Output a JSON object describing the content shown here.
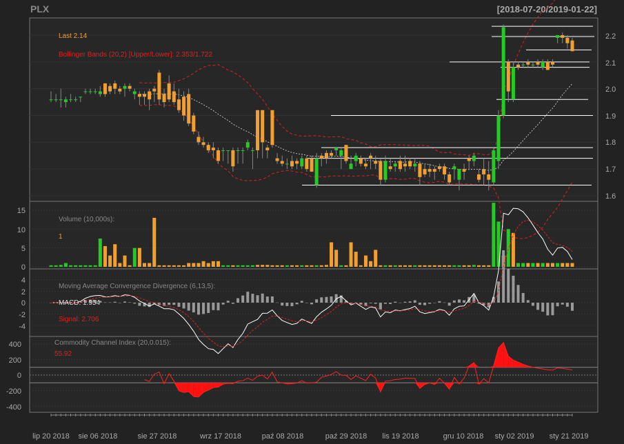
{
  "header": {
    "symbol": "PLX",
    "range": "[2018-07-20/2019-01-22]"
  },
  "colors": {
    "bg": "#222222",
    "panel": "#2b2b2b",
    "grid": "#3a3a3a",
    "frame": "#888888",
    "up": "#22cc22",
    "down": "#f0a030",
    "bb": "#dd2222",
    "text": "#aaaaaa",
    "last": "#f0a030",
    "label_red": "#dd2222",
    "white": "#ffffff",
    "title": "#999999"
  },
  "price_panel": {
    "last_label": "Last 2.14",
    "bb_label": "Bollinger Bands (20,2) [Upper/Lower]: 2.353/1.722",
    "yticks": [
      "2.2",
      "2.1",
      "2.0",
      "1.9",
      "1.8",
      "1.7",
      "1.6"
    ]
  },
  "volume_panel": {
    "title": "Volume (10,000s):",
    "value": "1",
    "yticks": [
      "15",
      "10",
      "5",
      "0"
    ]
  },
  "macd_panel": {
    "title": "Moving Average Convergence Divergence (6,13,5):",
    "macd_label": "MACD: 1.954",
    "signal_label": "Signal: 2.706",
    "yticks": [
      "4",
      "2",
      "0",
      "-2",
      "-4"
    ]
  },
  "cci_panel": {
    "title": "Commodity Channel Index (20,0.015):",
    "value": "55.92",
    "yticks": [
      "400",
      "200",
      "0",
      "-200",
      "-400"
    ]
  },
  "x_axis": {
    "labels": [
      "lip 20 2018",
      "sie 06 2018",
      "sie 27 2018",
      "wrz 17 2018",
      "paź 08 2018",
      "paź 29 2018",
      "lis 19 2018",
      "gru 10 2018",
      "sty 02 2019",
      "sty 21 2019"
    ]
  },
  "chart_data": {
    "type": "candlestick",
    "title": "PLX",
    "date_range": "[2018-07-20/2019-01-22]",
    "ylim_price": [
      1.57,
      2.27
    ],
    "ylim_volume": [
      0,
      18
    ],
    "ylim_macd": [
      -6,
      6
    ],
    "ylim_cci": [
      -500,
      500
    ],
    "candles": [
      {
        "o": 1.96,
        "h": 1.99,
        "l": 1.95,
        "c": 1.96,
        "v": 0.1
      },
      {
        "o": 1.96,
        "h": 1.98,
        "l": 1.95,
        "c": 1.96,
        "v": 0.1
      },
      {
        "o": 1.96,
        "h": 2.0,
        "l": 1.93,
        "c": 1.96,
        "v": 0.5
      },
      {
        "o": 1.95,
        "h": 1.97,
        "l": 1.93,
        "c": 1.96,
        "v": 1.0
      },
      {
        "o": 1.96,
        "h": 1.98,
        "l": 1.95,
        "c": 1.96,
        "v": 0.1
      },
      {
        "o": 1.96,
        "h": 1.97,
        "l": 1.95,
        "c": 1.96,
        "v": 0.1
      },
      {
        "o": 1.97,
        "h": 1.97,
        "l": 1.95,
        "c": 1.97,
        "v": 0.1
      },
      {
        "o": 1.99,
        "h": 2.0,
        "l": 1.98,
        "c": 1.99,
        "v": 0.1
      },
      {
        "o": 1.99,
        "h": 2.0,
        "l": 1.98,
        "c": 1.99,
        "v": 0.1
      },
      {
        "o": 1.99,
        "h": 2.0,
        "l": 1.98,
        "c": 1.99,
        "v": 0.1
      },
      {
        "o": 1.98,
        "h": 2.01,
        "l": 1.97,
        "c": 1.99,
        "v": 7.5
      },
      {
        "o": 2.02,
        "h": 2.02,
        "l": 1.97,
        "c": 1.98,
        "v": 5.5
      },
      {
        "o": 2.01,
        "h": 2.02,
        "l": 1.98,
        "c": 1.99,
        "v": 3.0
      },
      {
        "o": 2.02,
        "h": 2.03,
        "l": 1.98,
        "c": 2.0,
        "v": 6.0
      },
      {
        "o": 2.0,
        "h": 2.01,
        "l": 1.98,
        "c": 1.99,
        "v": 1.0
      },
      {
        "o": 2.0,
        "h": 2.02,
        "l": 1.97,
        "c": 2.01,
        "v": 0.1
      },
      {
        "o": 2.01,
        "h": 2.02,
        "l": 1.99,
        "c": 2.0,
        "v": 0.1
      },
      {
        "o": 1.98,
        "h": 2.0,
        "l": 1.96,
        "c": 1.99,
        "v": 1.5
      },
      {
        "o": 1.98,
        "h": 1.99,
        "l": 1.94,
        "c": 1.97,
        "v": 5.0
      },
      {
        "o": 1.98,
        "h": 1.99,
        "l": 1.94,
        "c": 1.97,
        "v": 1.0
      },
      {
        "o": 1.99,
        "h": 2.0,
        "l": 1.92,
        "c": 1.96,
        "v": 1.0
      },
      {
        "o": 2.0,
        "h": 2.01,
        "l": 1.95,
        "c": 1.99,
        "v": 13.0
      },
      {
        "o": 2.06,
        "h": 2.07,
        "l": 1.94,
        "c": 1.96,
        "v": 0.1
      },
      {
        "o": 1.98,
        "h": 2.0,
        "l": 1.93,
        "c": 1.95,
        "v": 0.1
      },
      {
        "o": 2.02,
        "h": 2.05,
        "l": 1.95,
        "c": 1.96,
        "v": 0.1
      },
      {
        "o": 1.99,
        "h": 2.02,
        "l": 1.94,
        "c": 1.95,
        "v": 0.1
      },
      {
        "o": 1.96,
        "h": 2.0,
        "l": 1.91,
        "c": 1.92,
        "v": 0.1
      },
      {
        "o": 1.97,
        "h": 1.99,
        "l": 1.88,
        "c": 1.9,
        "v": 0.1
      },
      {
        "o": 1.98,
        "h": 2.0,
        "l": 1.86,
        "c": 1.87,
        "v": 1.0
      },
      {
        "o": 1.9,
        "h": 1.91,
        "l": 1.83,
        "c": 1.84,
        "v": 1.0
      },
      {
        "o": 1.82,
        "h": 1.84,
        "l": 1.79,
        "c": 1.8,
        "v": 1.0
      },
      {
        "o": 1.8,
        "h": 1.82,
        "l": 1.78,
        "c": 1.79,
        "v": 1.5
      },
      {
        "o": 1.79,
        "h": 1.8,
        "l": 1.76,
        "c": 1.77,
        "v": 1.0
      },
      {
        "o": 1.78,
        "h": 1.8,
        "l": 1.74,
        "c": 1.77,
        "v": 1.5
      },
      {
        "o": 1.77,
        "h": 1.78,
        "l": 1.72,
        "c": 1.73,
        "v": 1.5
      },
      {
        "o": 1.77,
        "h": 1.78,
        "l": 1.73,
        "c": 1.77,
        "v": 0.1
      },
      {
        "o": 1.77,
        "h": 1.77,
        "l": 1.72,
        "c": 1.77,
        "v": 0.1
      },
      {
        "o": 1.77,
        "h": 1.78,
        "l": 1.69,
        "c": 1.71,
        "v": 0.1
      },
      {
        "o": 1.77,
        "h": 1.78,
        "l": 1.72,
        "c": 1.77,
        "v": 0.1
      },
      {
        "o": 1.77,
        "h": 1.78,
        "l": 1.72,
        "c": 1.77,
        "v": 0.1
      },
      {
        "o": 1.78,
        "h": 1.81,
        "l": 1.77,
        "c": 1.8,
        "v": 0.1
      },
      {
        "o": 1.77,
        "h": 1.78,
        "l": 1.7,
        "c": 1.77,
        "v": 0.1
      },
      {
        "o": 1.92,
        "h": 1.92,
        "l": 1.74,
        "c": 1.77,
        "v": 0.5
      },
      {
        "o": 1.92,
        "h": 1.92,
        "l": 1.74,
        "c": 1.8,
        "v": 0.5
      },
      {
        "o": 1.78,
        "h": 1.79,
        "l": 1.74,
        "c": 1.77,
        "v": 0.5
      },
      {
        "o": 1.92,
        "h": 1.92,
        "l": 1.78,
        "c": 1.79,
        "v": 0.1
      },
      {
        "o": 1.74,
        "h": 1.76,
        "l": 1.72,
        "c": 1.73,
        "v": 0.1
      },
      {
        "o": 1.73,
        "h": 1.75,
        "l": 1.71,
        "c": 1.72,
        "v": 0.1
      },
      {
        "o": 1.72,
        "h": 1.74,
        "l": 1.7,
        "c": 1.72,
        "v": 0.1
      },
      {
        "o": 1.73,
        "h": 1.75,
        "l": 1.7,
        "c": 1.71,
        "v": 0.1
      },
      {
        "o": 1.73,
        "h": 1.74,
        "l": 1.7,
        "c": 1.72,
        "v": 0.1
      },
      {
        "o": 1.71,
        "h": 1.75,
        "l": 1.7,
        "c": 1.74,
        "v": 0.1
      },
      {
        "o": 1.74,
        "h": 1.75,
        "l": 1.69,
        "c": 1.7,
        "v": 0.1
      },
      {
        "o": 1.74,
        "h": 1.75,
        "l": 1.69,
        "c": 1.69,
        "v": 0.1
      },
      {
        "o": 1.64,
        "h": 1.76,
        "l": 1.63,
        "c": 1.74,
        "v": 0.1
      },
      {
        "o": 1.75,
        "h": 1.76,
        "l": 1.71,
        "c": 1.74,
        "v": 0.1
      },
      {
        "o": 1.76,
        "h": 1.77,
        "l": 1.72,
        "c": 1.74,
        "v": 0.5
      },
      {
        "o": 1.76,
        "h": 1.77,
        "l": 1.74,
        "c": 1.75,
        "v": 1.0
      },
      {
        "o": 1.77,
        "h": 1.78,
        "l": 1.75,
        "c": 1.78,
        "v": 0.1
      },
      {
        "o": 1.75,
        "h": 1.78,
        "l": 1.7,
        "c": 1.77,
        "v": 0.1
      },
      {
        "o": 1.79,
        "h": 1.79,
        "l": 1.72,
        "c": 1.73,
        "v": 0.1
      },
      {
        "o": 1.7,
        "h": 1.75,
        "l": 1.7,
        "c": 1.72,
        "v": 0.1
      },
      {
        "o": 1.73,
        "h": 1.76,
        "l": 1.71,
        "c": 1.75,
        "v": 0.1
      },
      {
        "o": 1.74,
        "h": 1.75,
        "l": 1.71,
        "c": 1.72,
        "v": 0.1
      },
      {
        "o": 1.72,
        "h": 1.74,
        "l": 1.7,
        "c": 1.71,
        "v": 0.5
      },
      {
        "o": 1.75,
        "h": 1.76,
        "l": 1.7,
        "c": 1.74,
        "v": 1.5
      },
      {
        "o": 1.73,
        "h": 1.75,
        "l": 1.7,
        "c": 1.72,
        "v": 1.0
      },
      {
        "o": 1.73,
        "h": 1.74,
        "l": 1.64,
        "c": 1.66,
        "v": 0.1
      },
      {
        "o": 1.66,
        "h": 1.75,
        "l": 1.65,
        "c": 1.73,
        "v": 0.1
      },
      {
        "o": 1.71,
        "h": 1.74,
        "l": 1.69,
        "c": 1.7,
        "v": 0.1
      },
      {
        "o": 1.71,
        "h": 1.73,
        "l": 1.69,
        "c": 1.72,
        "v": 0.1
      },
      {
        "o": 1.73,
        "h": 1.75,
        "l": 1.69,
        "c": 1.7,
        "v": 0.1
      },
      {
        "o": 1.72,
        "h": 1.75,
        "l": 1.69,
        "c": 1.71,
        "v": 0.1
      },
      {
        "o": 1.73,
        "h": 1.74,
        "l": 1.7,
        "c": 1.71,
        "v": 0.1
      },
      {
        "o": 1.71,
        "h": 1.74,
        "l": 1.69,
        "c": 1.72,
        "v": 0.1
      },
      {
        "o": 1.72,
        "h": 1.73,
        "l": 1.64,
        "c": 1.67,
        "v": 0.1
      },
      {
        "o": 1.7,
        "h": 1.72,
        "l": 1.67,
        "c": 1.68,
        "v": 0.1
      },
      {
        "o": 1.7,
        "h": 1.72,
        "l": 1.67,
        "c": 1.69,
        "v": 0.1
      },
      {
        "o": 1.7,
        "h": 1.71,
        "l": 1.66,
        "c": 1.69,
        "v": 0.1
      },
      {
        "o": 1.71,
        "h": 1.72,
        "l": 1.69,
        "c": 1.7,
        "v": 0.1
      },
      {
        "o": 1.71,
        "h": 1.72,
        "l": 1.66,
        "c": 1.68,
        "v": 0.1
      },
      {
        "o": 1.68,
        "h": 1.69,
        "l": 1.64,
        "c": 1.65,
        "v": 0.1
      },
      {
        "o": 1.7,
        "h": 1.72,
        "l": 1.66,
        "c": 1.71,
        "v": 0.1
      },
      {
        "o": 1.66,
        "h": 1.7,
        "l": 1.62,
        "c": 1.7,
        "v": 0.1
      },
      {
        "o": 1.7,
        "h": 1.72,
        "l": 1.66,
        "c": 1.69,
        "v": 0.1
      },
      {
        "o": 1.74,
        "h": 1.75,
        "l": 1.7,
        "c": 1.73,
        "v": 0.1
      },
      {
        "o": 1.73,
        "h": 1.76,
        "l": 1.71,
        "c": 1.75,
        "v": 0.5
      },
      {
        "o": 1.68,
        "h": 1.7,
        "l": 1.65,
        "c": 1.66,
        "v": 0.1
      },
      {
        "o": 1.7,
        "h": 1.74,
        "l": 1.64,
        "c": 1.68,
        "v": 0.1
      },
      {
        "o": 1.68,
        "h": 1.73,
        "l": 1.62,
        "c": 1.66,
        "v": 0.1
      },
      {
        "o": 1.65,
        "h": 1.78,
        "l": 1.64,
        "c": 1.77,
        "v": 3.0
      },
      {
        "o": 1.73,
        "h": 1.92,
        "l": 1.7,
        "c": 1.9,
        "v": 0.1
      },
      {
        "o": 1.9,
        "h": 2.24,
        "l": 1.89,
        "c": 2.23,
        "v": 17.0
      },
      {
        "o": 2.1,
        "h": 2.11,
        "l": 1.95,
        "c": 1.99,
        "v": 3.0
      },
      {
        "o": 1.96,
        "h": 2.1,
        "l": 1.95,
        "c": 2.08,
        "v": 13.0
      },
      {
        "o": 2.09,
        "h": 2.1,
        "l": 2.07,
        "c": 2.08,
        "v": 9.0
      },
      {
        "o": 2.09,
        "h": 2.1,
        "l": 2.08,
        "c": 2.09,
        "v": 1.0
      },
      {
        "o": 2.1,
        "h": 2.11,
        "l": 2.08,
        "c": 2.09,
        "v": 1.0
      },
      {
        "o": 2.09,
        "h": 2.1,
        "l": 2.08,
        "c": 2.09,
        "v": 1.0
      },
      {
        "o": 2.1,
        "h": 2.11,
        "l": 2.08,
        "c": 2.09,
        "v": 1.0
      },
      {
        "o": 2.08,
        "h": 2.11,
        "l": 2.07,
        "c": 2.1,
        "v": 1.0
      },
      {
        "o": 2.1,
        "h": 2.11,
        "l": 2.07,
        "c": 2.07,
        "v": 1.0
      },
      {
        "o": 2.1,
        "h": 2.11,
        "l": 2.08,
        "c": 2.09,
        "v": 1.0
      },
      {
        "o": 2.19,
        "h": 2.2,
        "l": 2.17,
        "c": 2.2,
        "v": 1.0
      },
      {
        "o": 2.2,
        "h": 2.21,
        "l": 2.17,
        "c": 2.19,
        "v": 1.0
      },
      {
        "o": 2.19,
        "h": 2.2,
        "l": 2.15,
        "c": 2.17,
        "v": 1.0
      },
      {
        "o": 2.18,
        "h": 2.19,
        "l": 2.14,
        "c": 2.14,
        "v": 1.0
      }
    ],
    "vol_overrides": [
      {
        "i": 10,
        "v": 7.5,
        "up": true
      },
      {
        "i": 11,
        "v": 5.5,
        "up": false
      },
      {
        "i": 13,
        "v": 6.0,
        "up": false
      },
      {
        "i": 15,
        "v": 3.0,
        "up": false
      },
      {
        "i": 17,
        "v": 5.0,
        "up": true
      },
      {
        "i": 21,
        "v": 13.0,
        "up": false
      },
      {
        "i": 57,
        "v": 6.5,
        "up": false
      },
      {
        "i": 58,
        "v": 4.5,
        "up": false
      },
      {
        "i": 61,
        "v": 6.5,
        "up": false
      },
      {
        "i": 62,
        "v": 4.0,
        "up": false
      },
      {
        "i": 64,
        "v": 3.0,
        "up": false
      },
      {
        "i": 66,
        "v": 4.5,
        "up": false
      },
      {
        "i": 90,
        "v": 17.0,
        "up": true
      },
      {
        "i": 91,
        "v": 12.0,
        "up": true
      },
      {
        "i": 92,
        "v": 3.0,
        "up": false
      },
      {
        "i": 93,
        "v": 10.0,
        "up": true
      },
      {
        "i": 94,
        "v": 9.0,
        "up": false
      },
      {
        "i": 95,
        "v": 1.0,
        "up": true
      }
    ]
  }
}
